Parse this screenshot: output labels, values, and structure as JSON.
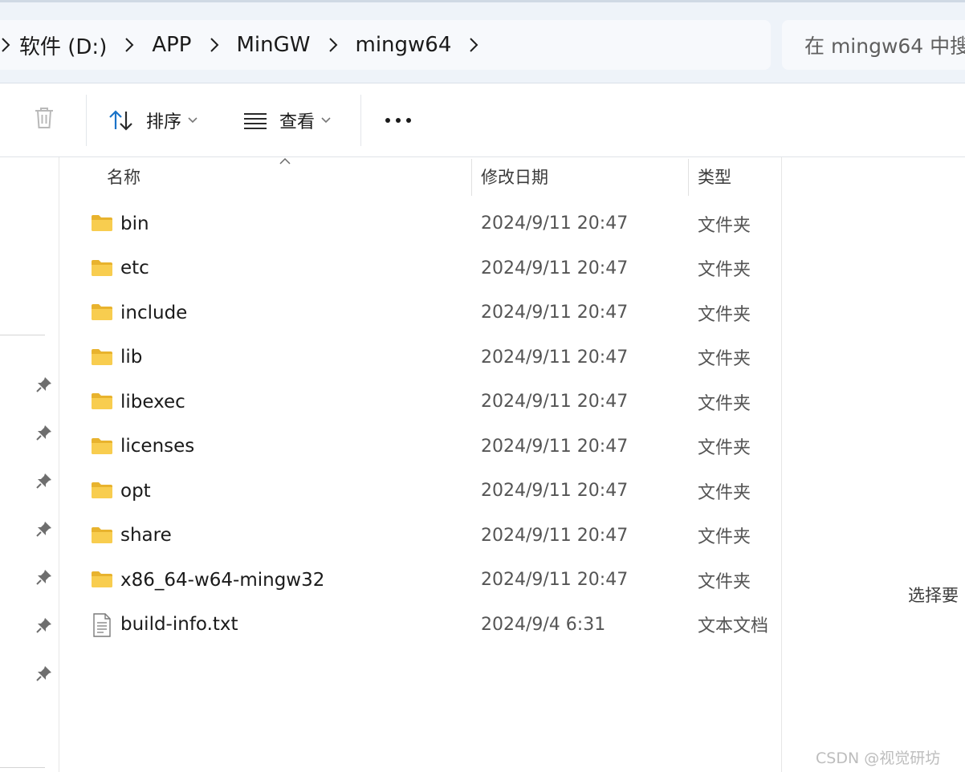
{
  "breadcrumb": {
    "items": [
      "软件 (D:)",
      "APP",
      "MinGW",
      "mingw64"
    ]
  },
  "search": {
    "placeholder": "在 mingw64 中搜"
  },
  "toolbar": {
    "delete_icon": "trash-icon",
    "sort_label": "排序",
    "view_label": "查看",
    "more_icon": "more-icon"
  },
  "columns": {
    "name": "名称",
    "date": "修改日期",
    "type": "类型"
  },
  "files": [
    {
      "name": "bin",
      "date": "2024/9/11 20:47",
      "type": "文件夹",
      "icon": "folder-icon"
    },
    {
      "name": "etc",
      "date": "2024/9/11 20:47",
      "type": "文件夹",
      "icon": "folder-icon"
    },
    {
      "name": "include",
      "date": "2024/9/11 20:47",
      "type": "文件夹",
      "icon": "folder-icon"
    },
    {
      "name": "lib",
      "date": "2024/9/11 20:47",
      "type": "文件夹",
      "icon": "folder-icon"
    },
    {
      "name": "libexec",
      "date": "2024/9/11 20:47",
      "type": "文件夹",
      "icon": "folder-icon"
    },
    {
      "name": "licenses",
      "date": "2024/9/11 20:47",
      "type": "文件夹",
      "icon": "folder-icon"
    },
    {
      "name": "opt",
      "date": "2024/9/11 20:47",
      "type": "文件夹",
      "icon": "folder-icon"
    },
    {
      "name": "share",
      "date": "2024/9/11 20:47",
      "type": "文件夹",
      "icon": "folder-icon"
    },
    {
      "name": "x86_64-w64-mingw32",
      "date": "2024/9/11 20:47",
      "type": "文件夹",
      "icon": "folder-icon"
    },
    {
      "name": "build-info.txt",
      "date": "2024/9/4 6:31",
      "type": "文本文档",
      "icon": "text-file-icon"
    }
  ],
  "details_pane": {
    "message": "选择要"
  },
  "watermark": "CSDN @视觉研坊",
  "colors": {
    "folder": "#F4C542",
    "topbar": "#EEF3F9",
    "accent": "#1A73C8"
  }
}
